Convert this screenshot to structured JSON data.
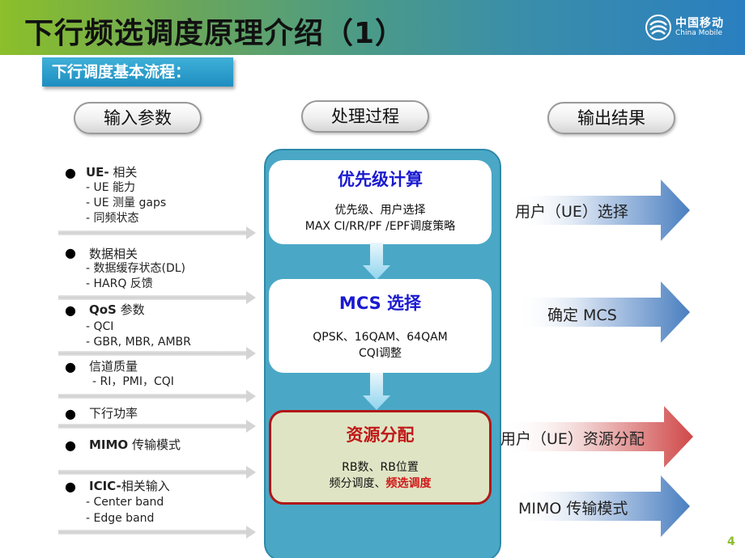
{
  "header": {
    "title": "下行频选调度原理介绍（1）",
    "logo": {
      "icon": "china-mobile-logo-icon",
      "cn": "中国移动",
      "en": "China Mobile"
    }
  },
  "subtitle": "下行调度基本流程：",
  "columns": {
    "input": "输入参数",
    "process": "处理过程",
    "output": "输出结果"
  },
  "inputs": [
    {
      "bold": "UE-",
      "label": " 相关",
      "subs": [
        "- UE 能力",
        "- UE 测量  gaps",
        "- 同频状态"
      ]
    },
    {
      "bold": "",
      "label": "数据相关",
      "subs": [
        "- 数据缓存状态(DL)",
        "- HARQ 反馈"
      ]
    },
    {
      "bold": "QoS",
      "label": "  参数",
      "subs": [
        "- QCI",
        "- GBR, MBR, AMBR"
      ]
    },
    {
      "bold": "",
      "label": "信道质量",
      "subs": [
        "-  RI，PMI，CQI"
      ]
    },
    {
      "bold": "",
      "label": "下行功率",
      "subs": []
    },
    {
      "bold": "MIMO",
      "label": " 传输模式",
      "subs": []
    },
    {
      "bold": "ICIC-",
      "label": "相关输入",
      "subs": [
        "- Center band",
        "- Edge band"
      ]
    }
  ],
  "process": [
    {
      "title": "优先级计算",
      "lines": [
        "优先级、用户选择",
        "MAX CI/RR/PF /EPF调度策略"
      ]
    },
    {
      "title": "MCS  选择",
      "lines": [
        "QPSK、16QAM、64QAM",
        "CQI调整"
      ]
    },
    {
      "title": "资源分配",
      "line1": "RB数、RB位置",
      "line2_normal": "频分调度、",
      "line2_highlight": "频选调度"
    }
  ],
  "outputs": [
    {
      "label": "用户（UE）选择",
      "color": "#4a7fc0"
    },
    {
      "label": "确定 MCS",
      "color": "#4a7fc0"
    },
    {
      "label": "用户（UE）资源分配",
      "color": "#d04848"
    },
    {
      "label": "MIMO 传输模式",
      "color": "#4a7fc0"
    }
  ],
  "page_number": "4"
}
